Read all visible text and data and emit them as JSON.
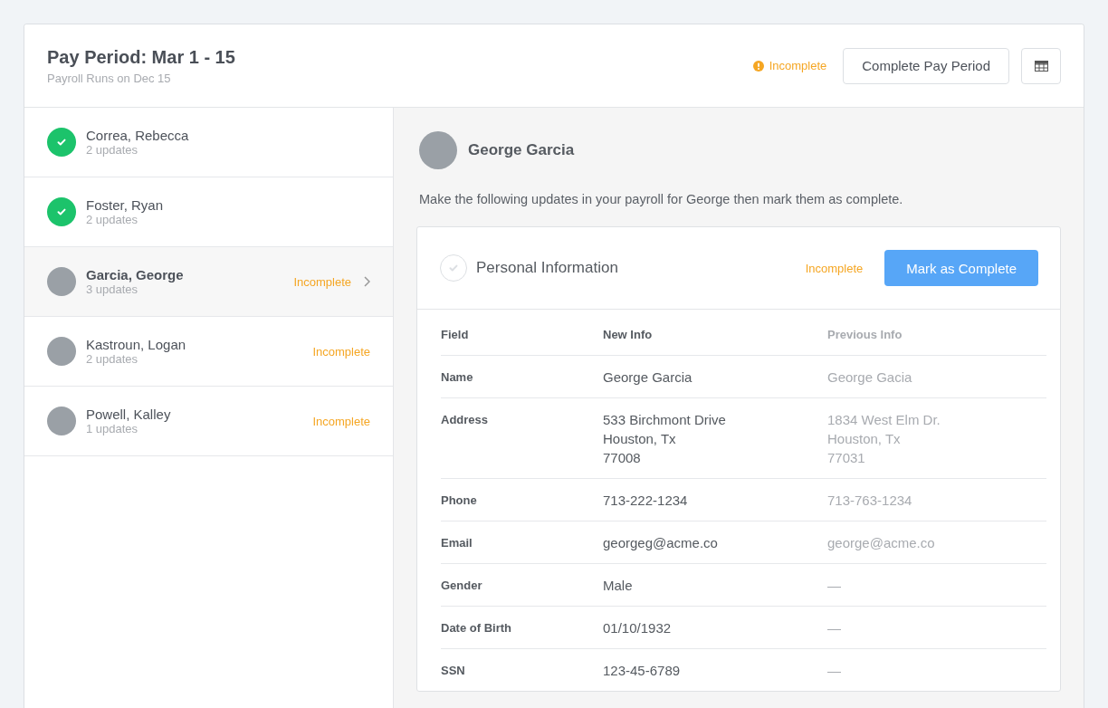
{
  "header": {
    "title": "Pay Period: Mar 1 - 15",
    "subtitle": "Payroll Runs on Dec 15",
    "status": {
      "kind": "incomplete",
      "label": "Incomplete"
    },
    "complete_button": "Complete Pay Period"
  },
  "employees": [
    {
      "name": "Correa, Rebecca",
      "updates": "2 updates",
      "kind": "complete",
      "selected": false
    },
    {
      "name": "Foster, Ryan",
      "updates": "2 updates",
      "kind": "complete",
      "selected": false
    },
    {
      "name": "Garcia, George",
      "updates": "3 updates",
      "kind": "incomplete",
      "status": "Incomplete",
      "selected": true
    },
    {
      "name": "Kastroun, Logan",
      "updates": "2 updates",
      "kind": "incomplete",
      "status": "Incomplete",
      "selected": false
    },
    {
      "name": "Powell, Kalley",
      "updates": "1 updates",
      "kind": "incomplete",
      "status": "Incomplete",
      "selected": false
    }
  ],
  "detail": {
    "name": "George Garcia",
    "instructions": "Make the following updates in your payroll for George then mark them as complete.",
    "section": {
      "title": "Personal Information",
      "complete": false,
      "status": "Incomplete",
      "button": "Mark as Complete",
      "columns": [
        "Field",
        "New Info",
        "Previous Info"
      ],
      "rows": [
        {
          "field": "Name",
          "new_info": [
            "George Garcia"
          ],
          "previous_info": [
            "George Gacia"
          ]
        },
        {
          "field": "Address",
          "new_info": [
            "533 Birchmont Drive",
            "Houston, Tx",
            "77008"
          ],
          "previous_info": [
            "1834 West Elm Dr.",
            "Houston, Tx",
            "77031"
          ]
        },
        {
          "field": "Phone",
          "new_info": [
            "713-222-1234"
          ],
          "previous_info": [
            "713-763-1234"
          ]
        },
        {
          "field": "Email",
          "new_info": [
            "georgeg@acme.co"
          ],
          "previous_info": [
            "george@acme.co"
          ]
        },
        {
          "field": "Gender",
          "new_info": [
            "Male"
          ],
          "previous_info": [
            "—"
          ]
        },
        {
          "field": "Date of Birth",
          "new_info": [
            "01/10/1932"
          ],
          "previous_info": [
            "—"
          ]
        },
        {
          "field": "SSN",
          "new_info": [
            "123-45-6789"
          ],
          "previous_info": [
            "—"
          ]
        }
      ]
    }
  }
}
